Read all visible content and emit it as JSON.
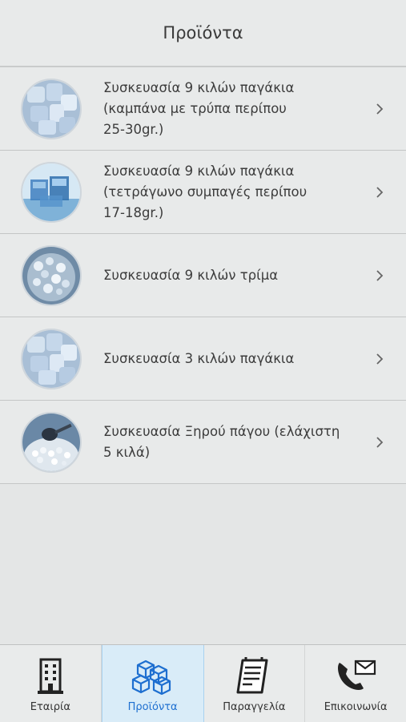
{
  "header": {
    "title": "Προϊόντα"
  },
  "products": [
    {
      "label": "Συσκευασία 9 κιλών παγάκια\n(καμπάνα με τρύπα περίπου\n25-30gr.)",
      "image": "ice-cubes"
    },
    {
      "label": "Συσκευασία 9 κιλών παγάκια\n(τετράγωνο συμπαγές περίπου\n17-18gr.)",
      "image": "square-ice-cubes"
    },
    {
      "label": "Συσκευασία 9 κιλών τρίμα",
      "image": "crushed-ice"
    },
    {
      "label": "Συσκευασία 3 κιλών παγάκια",
      "image": "ice-cubes"
    },
    {
      "label": "Συσκευασία Ξηρού πάγου (ελάχιστη\n5 κιλά)",
      "image": "dry-ice-pellets"
    }
  ],
  "tabs": [
    {
      "label": "Εταιρία",
      "icon": "building-icon",
      "active": false
    },
    {
      "label": "Προϊόντα",
      "icon": "boxes-icon",
      "active": true
    },
    {
      "label": "Παραγγελία",
      "icon": "order-form-icon",
      "active": false
    },
    {
      "label": "Επικοινωνία",
      "icon": "phone-mail-icon",
      "active": false
    }
  ],
  "colors": {
    "accent": "#1e6fd0",
    "active_tab_bg": "#d9ecf8",
    "background": "#e4e6e6"
  }
}
